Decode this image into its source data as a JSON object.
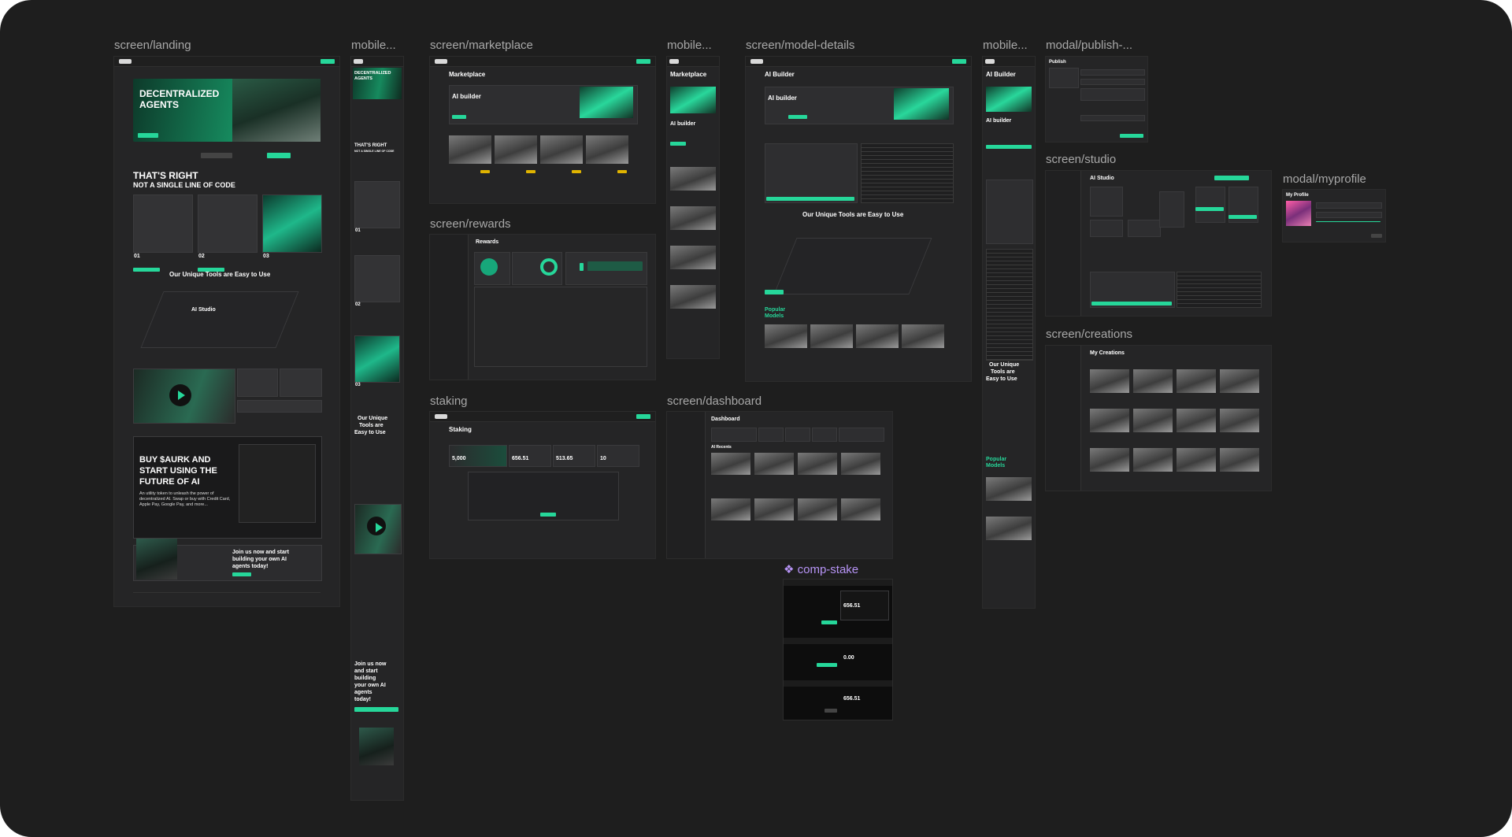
{
  "frames": {
    "landing": "screen/landing",
    "mobile_1": "mobile...",
    "marketplace": "screen/marketplace",
    "mobile_2": "mobile...",
    "model_details": "screen/model-details",
    "mobile_3": "mobile...",
    "publish": "modal/publish-...",
    "rewards": "screen/rewards",
    "staking": "staking",
    "dashboard": "screen/dashboard",
    "studio": "screen/studio",
    "myprofile": "modal/myprofile",
    "creations": "screen/creations",
    "comp_stake": "comp-stake"
  },
  "landing": {
    "hero_title_1": "DECENTRALIZED",
    "hero_title_2": "AGENTS",
    "headline_1": "THAT'S RIGHT",
    "headline_2": "NOT A SINGLE LINE OF CODE",
    "steps": [
      "01",
      "02",
      "03"
    ],
    "tools_title": "Our Unique Tools are Easy to Use",
    "studio_label": "AI Studio",
    "buy_title_1": "BUY $AURK AND",
    "buy_title_2": "START USING THE",
    "buy_title_3": "FUTURE OF AI",
    "buy_sub": "An utility token to unleash the power of decentralized AI. Swap or buy with Credit Card, Apple Pay, Google Pay, and more...",
    "join_1": "Join us now and start",
    "join_2": "building your own AI",
    "join_3": "agents today!"
  },
  "mobile1": {
    "hero_1": "DECENTRALIZED",
    "hero_2": "AGENTS",
    "headline_1": "THAT'S RIGHT",
    "headline_2": "NOT A SINGLE LINE OF CODE",
    "steps": [
      "01",
      "02",
      "03"
    ],
    "tools_1": "Our Unique",
    "tools_2": "Tools are",
    "tools_3": "Easy to Use",
    "join_1": "Join us now",
    "join_2": "and start",
    "join_3": "building",
    "join_4": "your own AI",
    "join_5": "agents",
    "join_6": "today!"
  },
  "marketplace": {
    "title": "Marketplace",
    "card_title": "AI builder"
  },
  "mobile2": {
    "title": "Marketplace",
    "card_title": "AI builder"
  },
  "model_details": {
    "title": "AI Builder",
    "card_title": "AI builder",
    "tools_title": "Our Unique Tools are Easy to Use",
    "popular_1": "Popular",
    "popular_2": "Models"
  },
  "mobile3": {
    "title": "AI Builder",
    "card_title": "AI builder",
    "tools_1": "Our Unique",
    "tools_2": "Tools are",
    "tools_3": "Easy to Use",
    "popular_1": "Popular",
    "popular_2": "Models"
  },
  "publish": {
    "title": "Publish"
  },
  "studio": {
    "title": "AI Studio"
  },
  "myprofile": {
    "title": "My Profile"
  },
  "creations": {
    "title": "My Creations"
  },
  "rewards": {
    "title": "Rewards"
  },
  "staking": {
    "title": "Staking",
    "stat_1": "5,000",
    "stat_2": "656.51",
    "stat_3": "513.65",
    "stat_4": "10"
  },
  "dashboard": {
    "title": "Dashboard",
    "section": "AI Recents"
  },
  "comp_stake": {
    "value_1": "656.51",
    "value_2": "0.00",
    "value_3": "656.51"
  },
  "colors": {
    "accent": "#26d79a",
    "warning": "#e0b400",
    "canvas": "#1e1e1e",
    "frame": "#252526"
  }
}
